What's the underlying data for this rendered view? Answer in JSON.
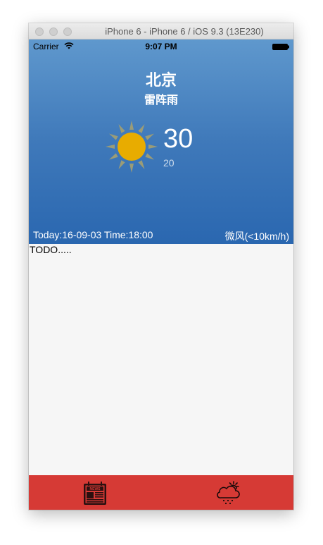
{
  "window": {
    "title": "iPhone 6 - iPhone 6 / iOS 9.3 (13E230)"
  },
  "status_bar": {
    "carrier": "Carrier",
    "time": "9:07 PM"
  },
  "weather": {
    "city": "北京",
    "condition": "雷阵雨",
    "temperature": "30",
    "temperature_low": "20",
    "date_line": "Today:16-09-03 Time:18:00",
    "wind": "微风(<10km/h)",
    "icon": "sun-icon"
  },
  "content": {
    "todo": "TODO....."
  },
  "tab_bar": {
    "background": "#d63a35",
    "tabs": [
      {
        "icon": "news-icon"
      },
      {
        "icon": "weather-cloud-icon"
      }
    ]
  },
  "colors": {
    "hero_top": "#5f98cd",
    "hero_bottom": "#2a67b0",
    "sun": "#e8ac00",
    "sun_rays": "#9a9c78"
  }
}
